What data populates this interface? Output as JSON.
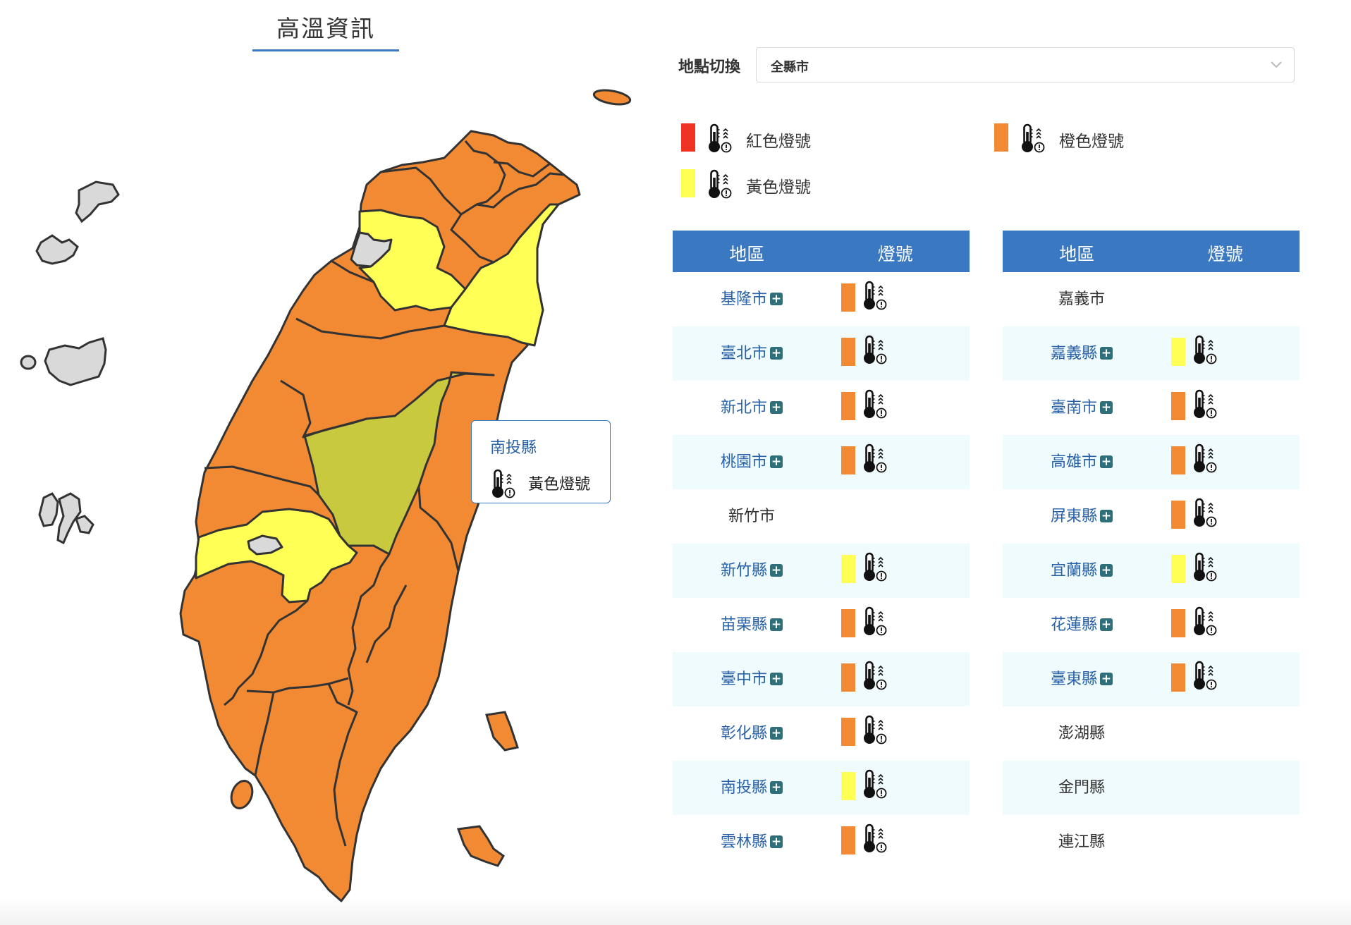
{
  "page": {
    "title": "高溫資訊"
  },
  "location": {
    "label": "地點切換",
    "selected": "全縣市"
  },
  "colors": {
    "red": "#ee3322",
    "orange": "#f28a33",
    "yellow": "#ffff55",
    "gray": "#d9d9d9",
    "header": "#3b78c2"
  },
  "legend": [
    {
      "level": "red",
      "label": "紅色燈號"
    },
    {
      "level": "orange",
      "label": "橙色燈號"
    },
    {
      "level": "yellow",
      "label": "黃色燈號"
    }
  ],
  "tooltip": {
    "name": "南投縣",
    "level_label": "黃色燈號",
    "icon": "thermometer-alert-icon"
  },
  "table": {
    "headers": [
      "地區",
      "燈號"
    ],
    "left": [
      {
        "name": "基隆市",
        "expandable": true,
        "level": "orange"
      },
      {
        "name": "臺北市",
        "expandable": true,
        "level": "orange"
      },
      {
        "name": "新北市",
        "expandable": true,
        "level": "orange"
      },
      {
        "name": "桃園市",
        "expandable": true,
        "level": "orange"
      },
      {
        "name": "新竹市",
        "expandable": false,
        "level": ""
      },
      {
        "name": "新竹縣",
        "expandable": true,
        "level": "yellow"
      },
      {
        "name": "苗栗縣",
        "expandable": true,
        "level": "orange"
      },
      {
        "name": "臺中市",
        "expandable": true,
        "level": "orange"
      },
      {
        "name": "彰化縣",
        "expandable": true,
        "level": "orange"
      },
      {
        "name": "南投縣",
        "expandable": true,
        "level": "yellow"
      },
      {
        "name": "雲林縣",
        "expandable": true,
        "level": "orange"
      }
    ],
    "right": [
      {
        "name": "嘉義市",
        "expandable": false,
        "level": ""
      },
      {
        "name": "嘉義縣",
        "expandable": true,
        "level": "yellow"
      },
      {
        "name": "臺南市",
        "expandable": true,
        "level": "orange"
      },
      {
        "name": "高雄市",
        "expandable": true,
        "level": "orange"
      },
      {
        "name": "屏東縣",
        "expandable": true,
        "level": "orange"
      },
      {
        "name": "宜蘭縣",
        "expandable": true,
        "level": "yellow"
      },
      {
        "name": "花蓮縣",
        "expandable": true,
        "level": "orange"
      },
      {
        "name": "臺東縣",
        "expandable": true,
        "level": "orange"
      },
      {
        "name": "澎湖縣",
        "expandable": false,
        "level": ""
      },
      {
        "name": "金門縣",
        "expandable": false,
        "level": ""
      },
      {
        "name": "連江縣",
        "expandable": false,
        "level": ""
      }
    ]
  }
}
